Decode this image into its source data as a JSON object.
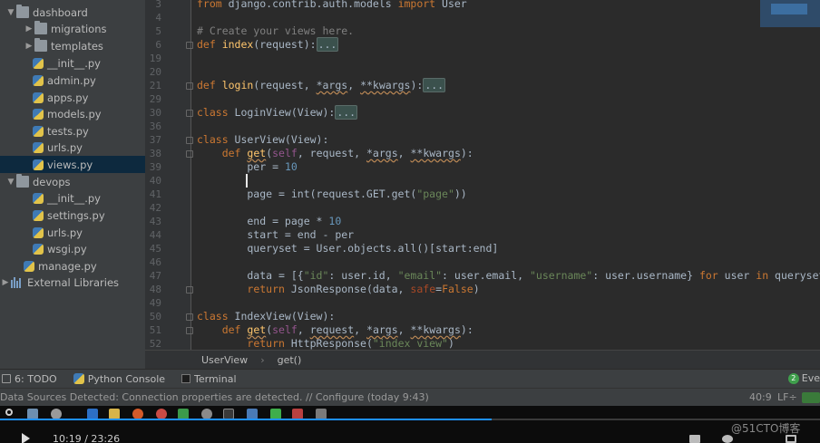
{
  "project_tree": {
    "items": [
      {
        "label": "dashboard",
        "type": "folder",
        "expanded": true,
        "indent": 0
      },
      {
        "label": "migrations",
        "type": "folder",
        "expanded": false,
        "indent": 1
      },
      {
        "label": "templates",
        "type": "folder",
        "expanded": false,
        "indent": 1
      },
      {
        "label": "__init__.py",
        "type": "py",
        "indent": 1
      },
      {
        "label": "admin.py",
        "type": "py",
        "indent": 1
      },
      {
        "label": "apps.py",
        "type": "py",
        "indent": 1
      },
      {
        "label": "models.py",
        "type": "py",
        "indent": 1
      },
      {
        "label": "tests.py",
        "type": "py",
        "indent": 1
      },
      {
        "label": "urls.py",
        "type": "py",
        "indent": 1
      },
      {
        "label": "views.py",
        "type": "py",
        "indent": 1,
        "selected": true
      },
      {
        "label": "devops",
        "type": "folder",
        "expanded": true,
        "indent": 0
      },
      {
        "label": "__init__.py",
        "type": "py",
        "indent": 1
      },
      {
        "label": "settings.py",
        "type": "py",
        "indent": 1
      },
      {
        "label": "urls.py",
        "type": "py",
        "indent": 1
      },
      {
        "label": "wsgi.py",
        "type": "py",
        "indent": 1
      },
      {
        "label": "manage.py",
        "type": "py",
        "indent": 0
      },
      {
        "label": "External Libraries",
        "type": "libs",
        "indent": -1
      }
    ]
  },
  "editor": {
    "lines": [
      {
        "n": "3",
        "tokens": [
          [
            "kw",
            "from "
          ],
          [
            "",
            "django.contrib.auth.models "
          ],
          [
            "kw",
            "import "
          ],
          [
            "",
            "User"
          ]
        ]
      },
      {
        "n": "4",
        "tokens": []
      },
      {
        "n": "5",
        "tokens": [
          [
            "cmt",
            "# Create your views here."
          ]
        ]
      },
      {
        "n": "6",
        "tokens": [
          [
            "kw",
            "def "
          ],
          [
            "fn",
            "index"
          ],
          [
            "",
            "(request):"
          ],
          [
            "folded",
            "..."
          ]
        ],
        "fold": true
      },
      {
        "n": "19",
        "tokens": []
      },
      {
        "n": "20",
        "tokens": []
      },
      {
        "n": "21",
        "tokens": [
          [
            "kw",
            "def "
          ],
          [
            "fn",
            "login"
          ],
          [
            "",
            "(request, "
          ],
          [
            "sq",
            "*args"
          ],
          [
            "",
            ", "
          ],
          [
            "sq",
            "**kwargs"
          ],
          [
            "",
            "):"
          ],
          [
            "folded",
            "..."
          ]
        ],
        "fold": true
      },
      {
        "n": "29",
        "tokens": []
      },
      {
        "n": "30",
        "tokens": [
          [
            "kw",
            "class "
          ],
          [
            "",
            "LoginView(View):"
          ],
          [
            "folded",
            "..."
          ]
        ],
        "fold": true
      },
      {
        "n": "36",
        "tokens": []
      },
      {
        "n": "37",
        "tokens": [
          [
            "kw",
            "class "
          ],
          [
            "",
            "UserView(View):"
          ]
        ],
        "fold": true
      },
      {
        "n": "38",
        "tokens": [
          [
            "",
            "    "
          ],
          [
            "kw",
            "def "
          ],
          [
            "fn sq",
            "get"
          ],
          [
            "",
            "("
          ],
          [
            "self",
            "self"
          ],
          [
            "",
            ", request, "
          ],
          [
            "sq",
            "*args"
          ],
          [
            "",
            ", "
          ],
          [
            "sq",
            "**kwargs"
          ],
          [
            "",
            "):"
          ]
        ],
        "fold": true
      },
      {
        "n": "39",
        "tokens": [
          [
            "",
            "        per = "
          ],
          [
            "num",
            "10"
          ]
        ]
      },
      {
        "n": "40",
        "tokens": []
      },
      {
        "n": "41",
        "tokens": [
          [
            "",
            "        page = int(request.GET.get("
          ],
          [
            "str",
            "\"page\""
          ],
          [
            "",
            "))"
          ]
        ]
      },
      {
        "n": "42",
        "tokens": []
      },
      {
        "n": "43",
        "tokens": [
          [
            "",
            "        end = page * "
          ],
          [
            "num",
            "10"
          ]
        ]
      },
      {
        "n": "44",
        "tokens": [
          [
            "",
            "        start = end - per"
          ]
        ]
      },
      {
        "n": "45",
        "tokens": [
          [
            "",
            "        queryset = User.objects.all()[start:end]"
          ]
        ]
      },
      {
        "n": "46",
        "tokens": []
      },
      {
        "n": "47",
        "tokens": [
          [
            "",
            "        data = [{"
          ],
          [
            "str",
            "\"id\""
          ],
          [
            "",
            ": user.id, "
          ],
          [
            "str",
            "\"email\""
          ],
          [
            "",
            ": user.email, "
          ],
          [
            "str",
            "\"username\""
          ],
          [
            "",
            ": user.username} "
          ],
          [
            "kw",
            "for "
          ],
          [
            "",
            "user "
          ],
          [
            "kw",
            "in "
          ],
          [
            "",
            "queryset]"
          ]
        ]
      },
      {
        "n": "48",
        "tokens": [
          [
            "",
            "        "
          ],
          [
            "kw",
            "return "
          ],
          [
            "",
            "JsonResponse(data, "
          ],
          [
            "kwarg",
            "safe"
          ],
          [
            "",
            "="
          ],
          [
            "kw",
            "False"
          ],
          [
            "",
            ")"
          ]
        ],
        "fold": true
      },
      {
        "n": "49",
        "tokens": []
      },
      {
        "n": "50",
        "tokens": [
          [
            "kw",
            "class "
          ],
          [
            "",
            "IndexView(View):"
          ]
        ],
        "fold": true
      },
      {
        "n": "51",
        "tokens": [
          [
            "",
            "    "
          ],
          [
            "kw",
            "def "
          ],
          [
            "fn sq",
            "get"
          ],
          [
            "",
            "("
          ],
          [
            "self",
            "self"
          ],
          [
            "",
            ", "
          ],
          [
            "sq",
            "request"
          ],
          [
            "",
            ", "
          ],
          [
            "sq",
            "*args"
          ],
          [
            "",
            ", "
          ],
          [
            "sq",
            "**kwargs"
          ],
          [
            "",
            "):"
          ]
        ],
        "fold": true
      },
      {
        "n": "52",
        "tokens": [
          [
            "",
            "        "
          ],
          [
            "kw",
            "return "
          ],
          [
            "",
            "HttpResponse("
          ],
          [
            "str",
            "\"index view\""
          ],
          [
            "",
            ")"
          ]
        ]
      }
    ]
  },
  "breadcrumb": {
    "items": [
      "UserView",
      "get()"
    ]
  },
  "tool_windows": {
    "todo": "6: TODO",
    "python_console": "Python Console",
    "terminal": "Terminal",
    "event_log": "Eve"
  },
  "status_bar": {
    "message": "Data Sources Detected: Connection properties are detected. // Configure (today 9:43)",
    "caret_position": "40:9",
    "line_separator": "LF÷"
  },
  "video_overlay": {
    "time": "10:19 / 23:26",
    "progress": 0.6,
    "watermark": "@51CTO博客"
  },
  "colors": {
    "accent": "#0d293e",
    "progress": "#1e90ff"
  }
}
